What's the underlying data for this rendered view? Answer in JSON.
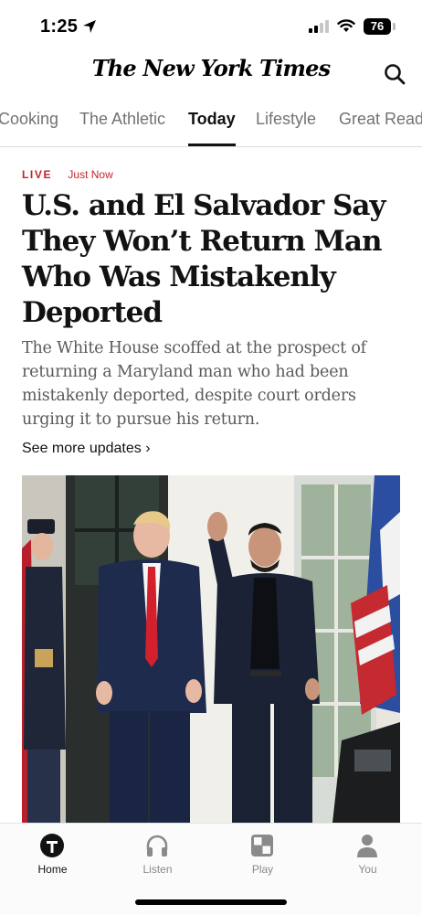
{
  "status_bar": {
    "time": "1:25",
    "battery": "76",
    "icons": [
      "location-arrow-icon",
      "signal-icon",
      "wifi-icon",
      "battery-icon"
    ]
  },
  "masthead": {
    "logo_text": "The New York Times",
    "search_icon": "search-icon"
  },
  "sections": {
    "tabs": [
      {
        "label": "Cooking",
        "active": false
      },
      {
        "label": "The Athletic",
        "active": false
      },
      {
        "label": "Today",
        "active": true
      },
      {
        "label": "Lifestyle",
        "active": false
      },
      {
        "label": "Great Read",
        "active": false
      }
    ]
  },
  "article": {
    "live_label": "LIVE",
    "time_label": "Just Now",
    "headline": "U.S. and El Salvador Say They Won’t Return Man Who Was Mistakenly Deported",
    "summary": "The White House scoffed at the prospect of returning a Maryland man who had been mistakenly deported, despite court orders urging it to pursue his return.",
    "updates_link": "See more updates ›"
  },
  "tab_bar": {
    "items": [
      {
        "label": "Home",
        "icon": "nyt-t-icon",
        "active": true
      },
      {
        "label": "Listen",
        "icon": "headphones-icon",
        "active": false
      },
      {
        "label": "Play",
        "icon": "games-grid-icon",
        "active": false
      },
      {
        "label": "You",
        "icon": "person-icon",
        "active": false
      }
    ]
  },
  "colors": {
    "live_red": "#c0252b",
    "text_primary": "#121212",
    "text_secondary": "#5a5a5a",
    "tab_inactive": "#8a8a8a"
  }
}
